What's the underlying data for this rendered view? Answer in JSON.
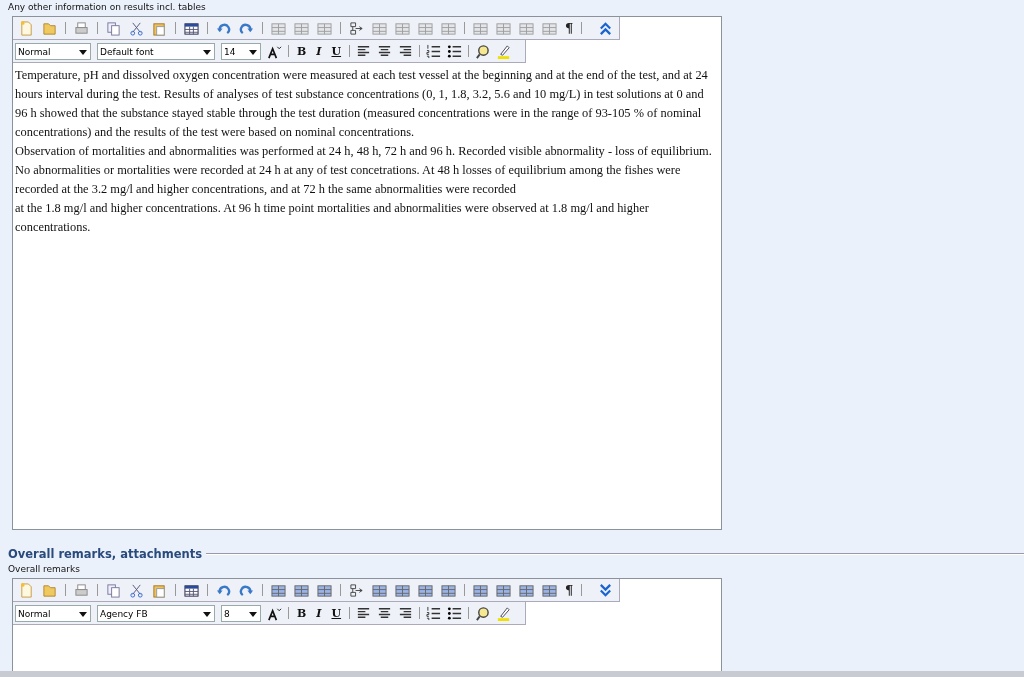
{
  "field_label": "Any other information on results incl. tables",
  "editors": [
    {
      "expanded": true,
      "table_tools_enabled": false,
      "style": "Normal",
      "font": "Default font",
      "size": "14",
      "bold": "B",
      "italic": "I",
      "underline": "U",
      "pilcrow": "¶",
      "paragraphs": [
        "Temperature, pH and dissolved oxygen concentration were measured at each test vessel at the beginning and at the end of the test, and at 24 hours interval during the test. Results of analyses of test substance concentrations (0, 1, 1.8, 3.2, 5.6 and 10 mg/L) in test solutions at 0 and 96 h showed that the substance stayed stable through the test duration (measured concentrations were in the range of 93-105 % of nominal concentrations) and the results of the test were based on nominal concentrations.",
        "Observation of mortalities and abnormalities was performed at 24 h, 48 h, 72 h and 96 h. Recorded visible abnormality - loss of equilibrium. No abnormalities or mortalities were recorded at 24 h at any of test concetrations. At 48 h losses of equilibrium among the fishes were recorded at the 3.2 mg/l and higher concentrations, and at 72 h the same abnormalities were recorded",
        "at the 1.8 mg/l and higher concentrations. At 96 h time point mortalities and abnormalities were observed at 1.8 mg/l and higher concentrations."
      ]
    },
    {
      "expanded": false,
      "table_tools_enabled": true,
      "style": "Normal",
      "font": "Agency FB",
      "size": "8",
      "bold": "B",
      "italic": "I",
      "underline": "U",
      "pilcrow": "¶"
    }
  ],
  "section": {
    "title": "Overall remarks, attachments",
    "field_label": "Overall remarks"
  }
}
